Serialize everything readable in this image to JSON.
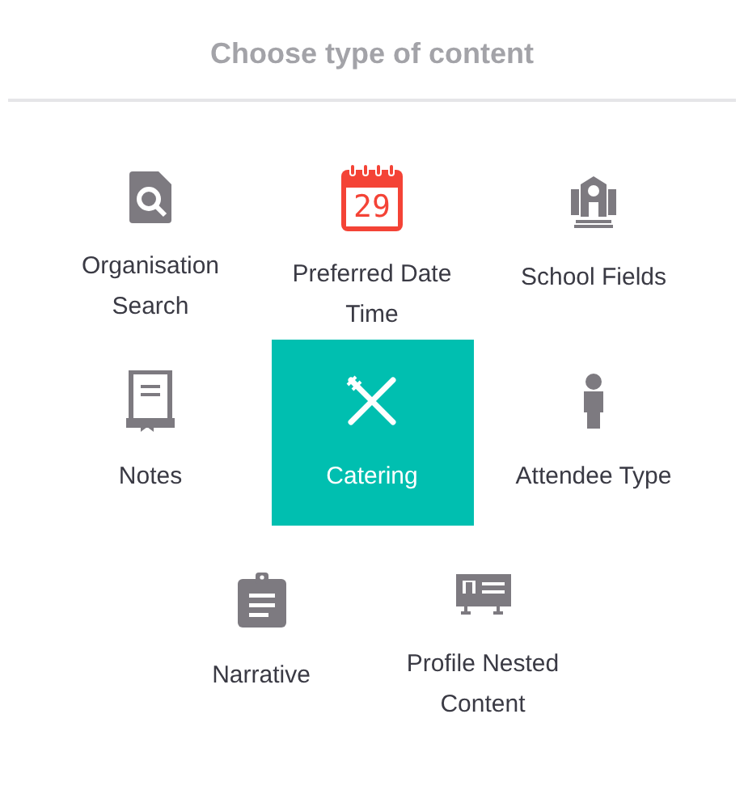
{
  "title": "Choose type of content",
  "items": [
    {
      "label": "Organisation Search",
      "selected": false
    },
    {
      "label": "Preferred Date Time",
      "icon_text": "29",
      "selected": false
    },
    {
      "label": "School Fields",
      "selected": false
    },
    {
      "label": "Notes",
      "selected": false
    },
    {
      "label": "Catering",
      "selected": true
    },
    {
      "label": "Attendee Type",
      "selected": false
    },
    {
      "label": "Narrative",
      "selected": false
    },
    {
      "label": "Profile Nested Content",
      "selected": false
    }
  ]
}
